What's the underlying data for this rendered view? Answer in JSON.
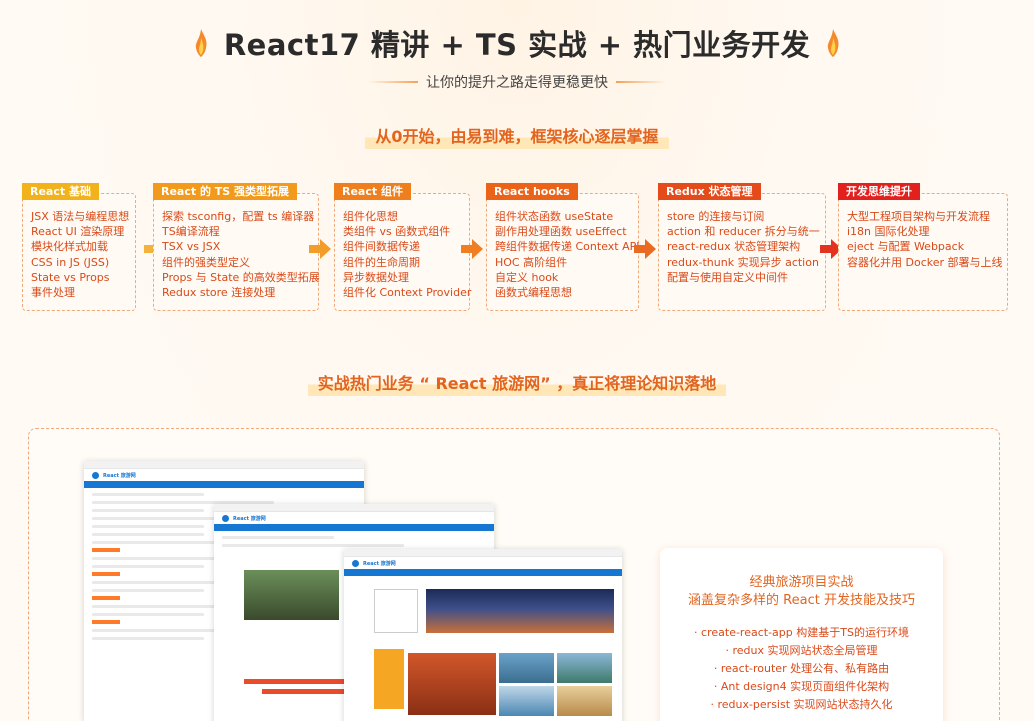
{
  "header": {
    "title": "React17 精讲 + TS 实战 + 热门业务开发",
    "subtitle": "让你的提升之路走得更稳更快"
  },
  "path_section": {
    "heading": "从0开始，由易到难，框架核心逐层掌握",
    "stages": [
      {
        "tag": "React 基础",
        "color": "#f2b21b",
        "items": [
          "JSX 语法与编程思想",
          "React UI 渲染原理",
          "模块化样式加载",
          "CSS in JS (JSS)",
          "State vs Props",
          "事件处理"
        ]
      },
      {
        "tag": "React 的 TS 强类型拓展",
        "color": "#f19a1b",
        "items": [
          "探索 tsconfig，配置 ts 编译器",
          "TS编译流程",
          "TSX vs JSX",
          "组件的强类型定义",
          "Props 与 State 的高效类型拓展",
          "Redux store 连接处理"
        ]
      },
      {
        "tag": "React 组件",
        "color": "#ef7f1c",
        "items": [
          "组件化思想",
          "类组件 vs 函数式组件",
          "组件间数据传递",
          "组件的生命周期",
          "异步数据处理",
          "组件化 Context Provider"
        ]
      },
      {
        "tag": "React hooks",
        "color": "#ea6319",
        "items": [
          "组件状态函数 useState",
          "副作用处理函数 useEffect",
          "跨组件数据传递 Context API",
          "HOC 高阶组件",
          "自定义 hook",
          "函数式编程思想"
        ]
      },
      {
        "tag": "Redux 状态管理",
        "color": "#e54a1a",
        "items": [
          "store 的连接与订阅",
          "action 和 reducer 拆分与统一",
          "react-redux 状态管理架构",
          "redux-thunk 实现异步 action",
          "配置与使用自定义中间件"
        ]
      },
      {
        "tag": "开发思维提升",
        "color": "#e2201d",
        "items": [
          "大型工程项目架构与开发流程",
          "i18n 国际化处理",
          "eject 与配置 Webpack",
          "容器化并用 Docker 部署与上线"
        ]
      }
    ]
  },
  "project_section": {
    "heading": "实战热门业务 “ React 旅游网” ，真正将理论知识落地",
    "screenshot_brand": "React 旅游网",
    "card": {
      "title_line1": "经典旅游项目实战",
      "title_line2": "涵盖复杂多样的 React 开发技能及技巧",
      "items": [
        "· create-react-app 构建基于TS的运行环境",
        "· redux 实现网站状态全局管理",
        "· react-router 处理公有、私有路由",
        "· Ant design4 实现页面组件化架构",
        "· redux-persist 实现网站状态持久化"
      ]
    }
  },
  "colors": {
    "accent": "#e2641f",
    "item_text": "#d94a1a",
    "dashed_border": "#f1a87a",
    "screenshot_nav": "#1677d2"
  }
}
